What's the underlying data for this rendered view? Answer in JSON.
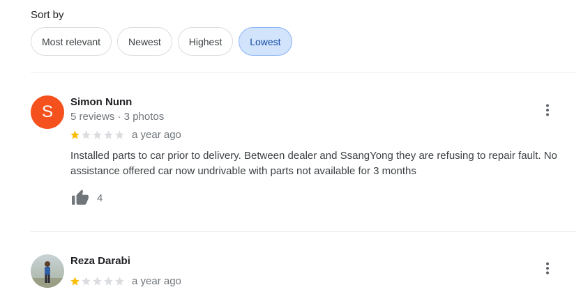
{
  "sort": {
    "label": "Sort by",
    "options": [
      {
        "label": "Most relevant",
        "selected": false
      },
      {
        "label": "Newest",
        "selected": false
      },
      {
        "label": "Highest",
        "selected": false
      },
      {
        "label": "Lowest",
        "selected": true
      }
    ]
  },
  "reviews": [
    {
      "avatar_letter": "S",
      "avatar_color": "#f4511e",
      "name": "Simon Nunn",
      "meta": "5 reviews · 3 photos",
      "rating": 1,
      "max_rating": 5,
      "date": "a year ago",
      "text": "Installed parts to car prior to delivery. Between dealer and SsangYong they are refusing to repair fault. No assistance offered car now undrivable with parts not available for 3 months",
      "likes": "4"
    },
    {
      "avatar_type": "photo",
      "name": "Reza Darabi",
      "rating": 1,
      "max_rating": 5,
      "date": "a year ago"
    }
  ],
  "colors": {
    "star_filled": "#fbbc04",
    "star_empty": "#dadce0",
    "chip_selected_bg": "#d2e3fc",
    "chip_selected_text": "#174ea6"
  }
}
